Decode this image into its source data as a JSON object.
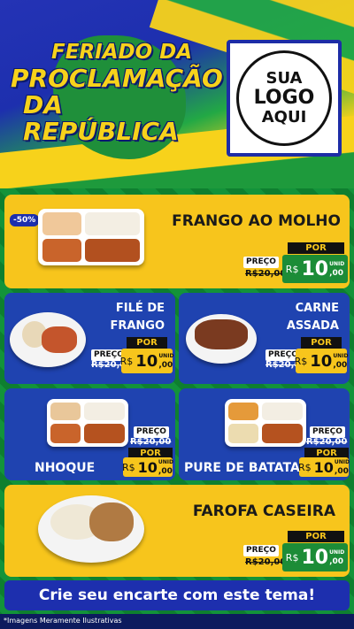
{
  "header": {
    "title_line1": "FERIADO DA",
    "title_line2": "PROCLAMAÇÃO",
    "title_line3": "DA REPÚBLICA",
    "logo_line1": "SUA",
    "logo_line2": "LOGO",
    "logo_line3": "AQUI"
  },
  "products": [
    {
      "name": "FRANGO AO MOLHO",
      "badge": "-50%",
      "por": "POR",
      "preco": "PREÇO",
      "old_price": "R$20,00",
      "currency": "R$",
      "price_int": "10",
      "price_cents": ",00",
      "unit": "UNID"
    },
    {
      "name_line1": "FILÉ DE",
      "name_line2": "FRANGO",
      "por": "POR",
      "preco": "PREÇO",
      "old_price": "R$20,00",
      "currency": "R$",
      "price_int": "10",
      "price_cents": ",00",
      "unit": "UNID"
    },
    {
      "name_line1": "CARNE",
      "name_line2": "ASSADA",
      "por": "POR",
      "preco": "PREÇO",
      "old_price": "R$20,00",
      "currency": "R$",
      "price_int": "10",
      "price_cents": ",00",
      "unit": "UNID"
    },
    {
      "name": "NHOQUE",
      "por": "POR",
      "preco": "PREÇO",
      "old_price": "R$20,00",
      "currency": "R$",
      "price_int": "10",
      "price_cents": ",00",
      "unit": "UNID"
    },
    {
      "name": "PURE DE BATATA",
      "por": "POR",
      "preco": "PREÇO",
      "old_price": "R$20,00",
      "currency": "R$",
      "price_int": "10",
      "price_cents": ",00",
      "unit": "UNID"
    },
    {
      "name": "FAROFA CASEIRA",
      "por": "POR",
      "preco": "PREÇO",
      "old_price": "R$20,00",
      "currency": "R$",
      "price_int": "10",
      "price_cents": ",00",
      "unit": "UNID"
    }
  ],
  "cta": "Crie seu encarte com este tema!",
  "footnote": "*Imagens Meramente Ilustrativas",
  "colors": {
    "yellow": "#f7c51c",
    "blue": "#1d2fae",
    "green": "#1c8c37"
  }
}
